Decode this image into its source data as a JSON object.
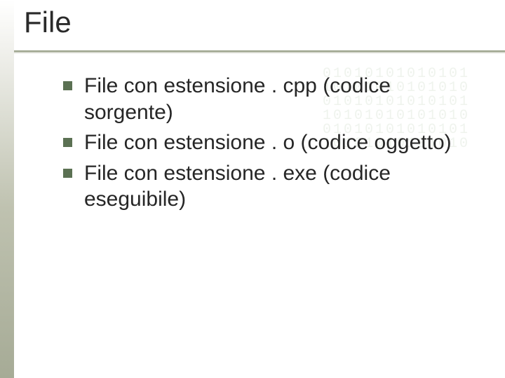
{
  "title": "File",
  "bullets": [
    "File con estensione . cpp (codice sorgente)",
    "File con estensione . o (codice oggetto)",
    "File con estensione . exe (codice eseguibile)"
  ],
  "binary_decor": "01010101010101\n10101010101010\n01010101010101\n10101010101010\n01010101010101\n10101010101010",
  "colors": {
    "bullet": "#5b7153",
    "underline": "#9aa28a"
  }
}
